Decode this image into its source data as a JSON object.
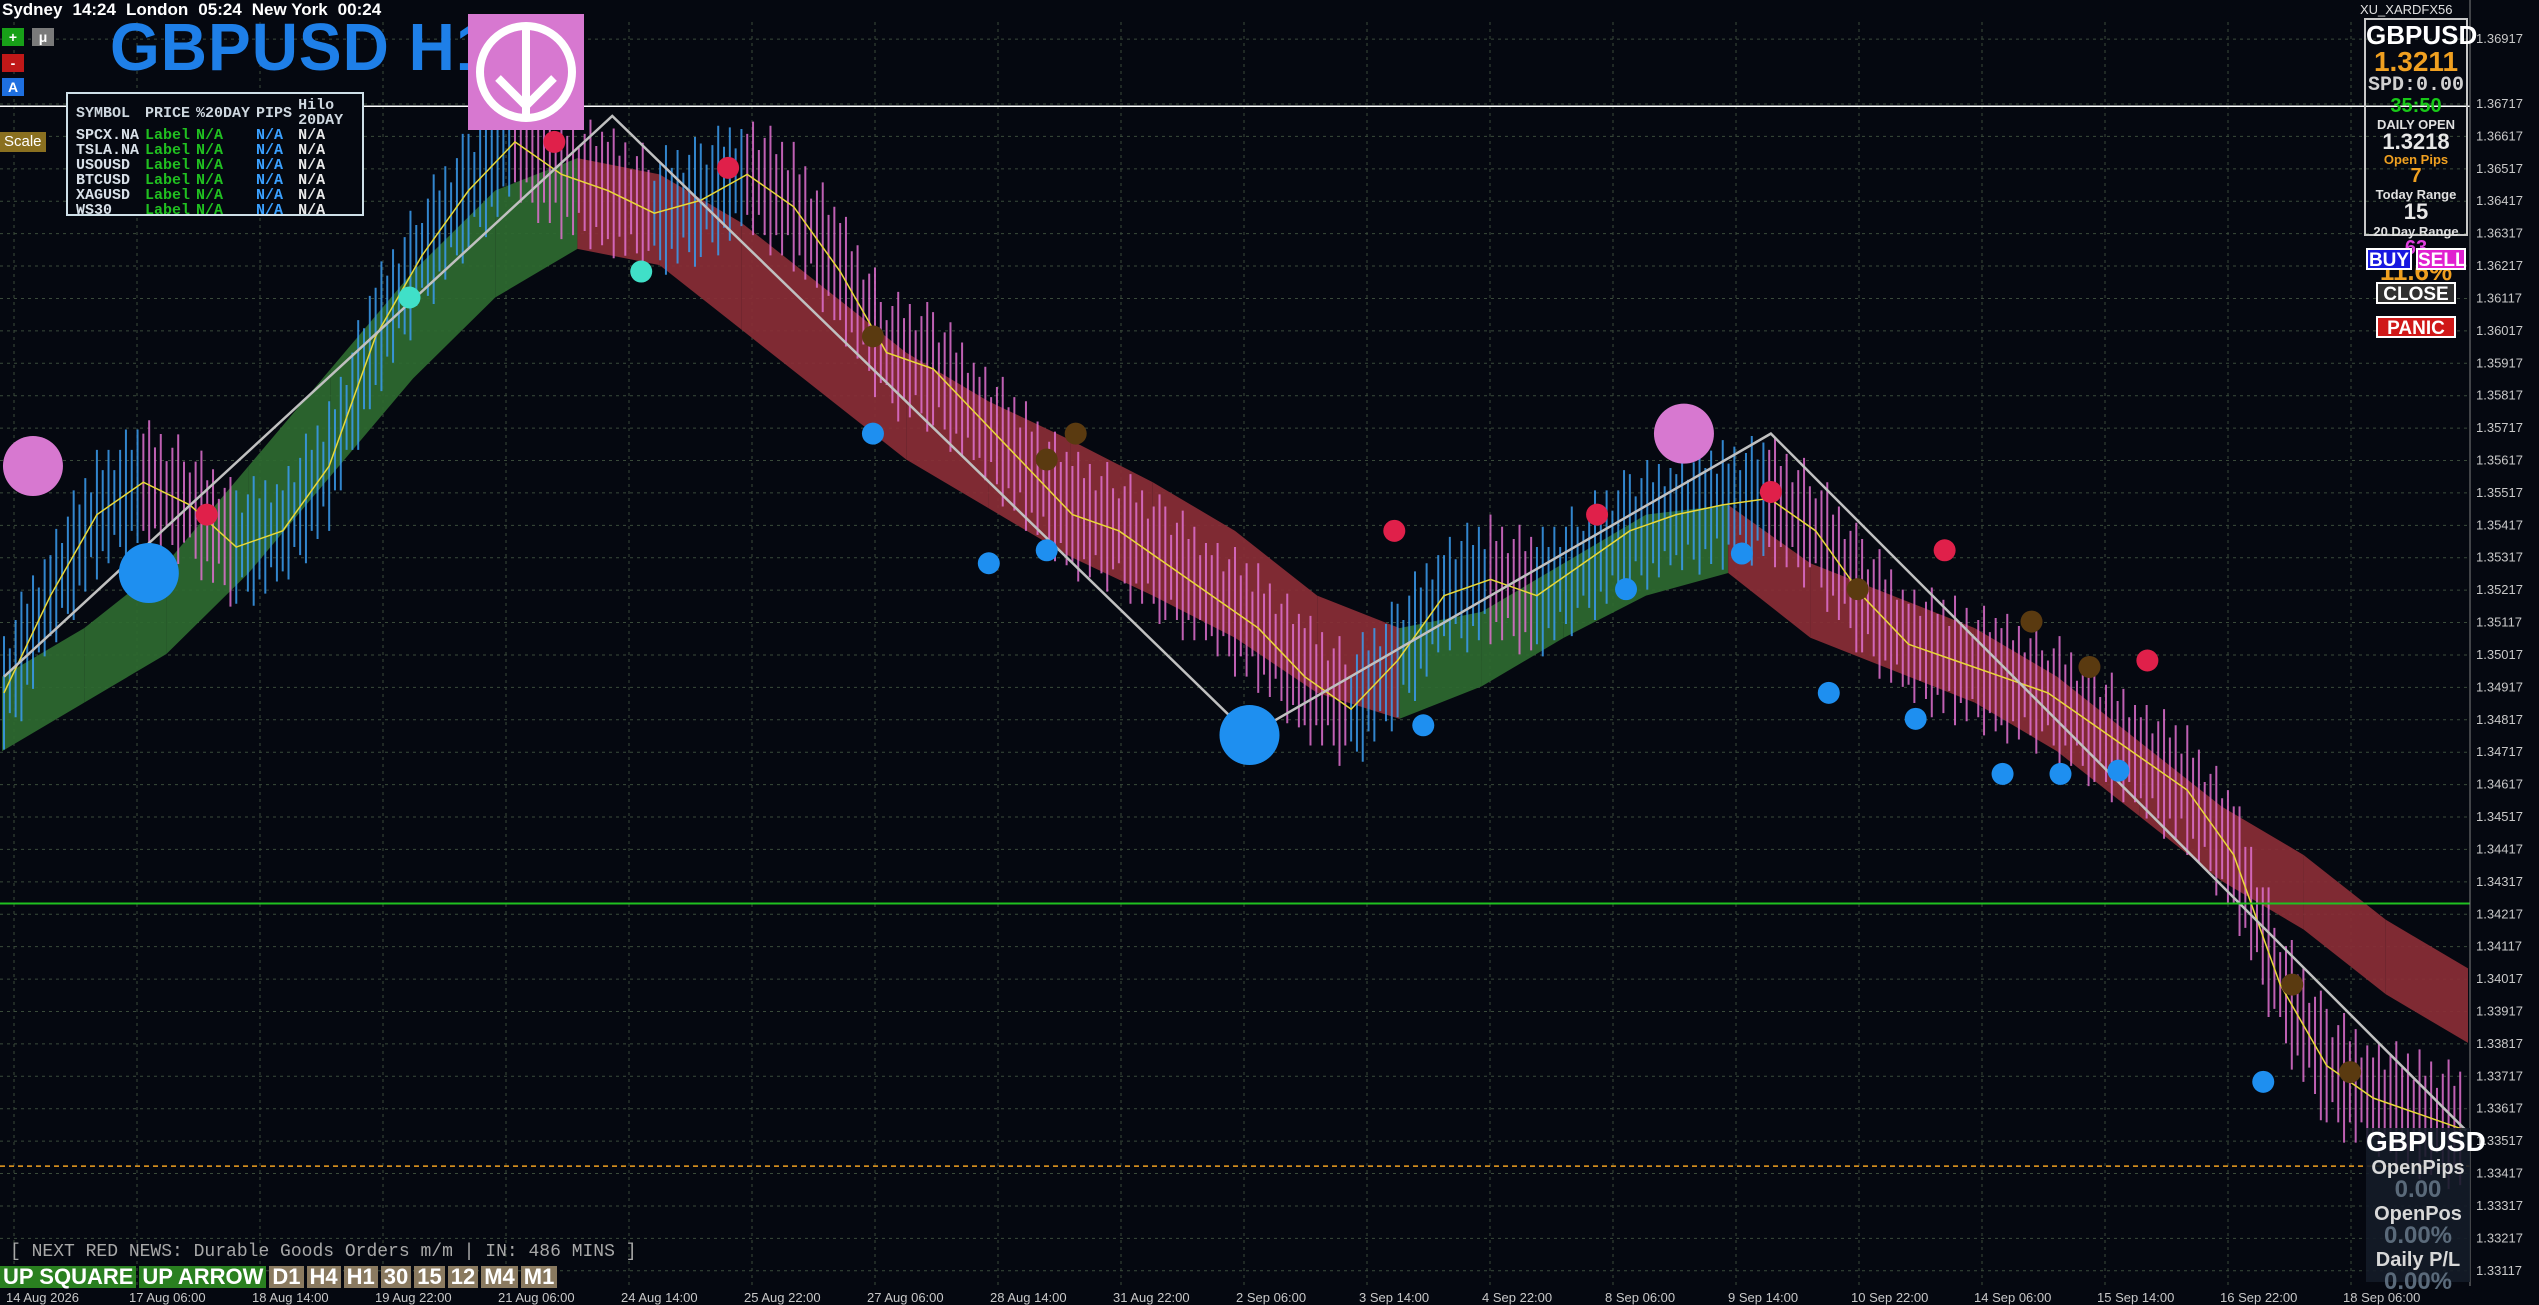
{
  "clock": {
    "city1": "Sydney",
    "time1": "14:24",
    "city2": "London",
    "time2": "05:24",
    "city3": "New York",
    "time3": "00:24"
  },
  "buttons": {
    "plus": "+",
    "mu": "μ",
    "minus": "-",
    "a": "A",
    "scale": "Scale"
  },
  "chart_title": "GBPUSD H1",
  "symbols_table": {
    "headers": [
      "SYMBOL",
      "PRICE",
      "%20DAY",
      "PIPS",
      "Hilo 20DAY"
    ],
    "rows": [
      [
        "SPCX.NA",
        "Label",
        "N/A",
        "N/A",
        "N/A"
      ],
      [
        "TSLA.NA",
        "Label",
        "N/A",
        "N/A",
        "N/A"
      ],
      [
        "USOUSD",
        "Label",
        "N/A",
        "N/A",
        "N/A"
      ],
      [
        "BTCUSD",
        "Label",
        "N/A",
        "N/A",
        "N/A"
      ],
      [
        "XAGUSD",
        "Label",
        "N/A",
        "N/A",
        "N/A"
      ],
      [
        "WS30",
        "Label",
        "N/A",
        "N/A",
        "N/A"
      ]
    ]
  },
  "account": "XU_XARDFX56",
  "info_panel": {
    "symbol": "GBPUSD",
    "price": "1.3211",
    "spread": "SPD:0.00",
    "countdown": "35:50",
    "daily_open_label": "DAILY OPEN",
    "daily_open": "1.3218",
    "open_pips_label": "Open Pips",
    "open_pips": "7",
    "today_range_label": "Today Range",
    "today_range": "15",
    "day20_range_label": "20 Day Range",
    "day20_range": "63",
    "pct": "11.6%"
  },
  "trade_buttons": {
    "buy": "BUY",
    "sell": "SELL",
    "close": "CLOSE",
    "panic": "PANIC"
  },
  "bottom_panel": {
    "symbol": "GBPUSD",
    "open_pips_label": "OpenPips",
    "open_pips": "0.00",
    "open_pos_label": "OpenPos",
    "open_pos": "0.00%",
    "daily_pl_label": "Daily P/L",
    "daily_pl": "0.00%"
  },
  "news": "[ NEXT RED NEWS: Durable Goods Orders m/m | IN: 486 MINS ]",
  "timeframe_bar": {
    "mode": "UP SQUARE",
    "arrow": "UP ARROW",
    "frames": [
      "D1",
      "H4",
      "H1",
      "30",
      "15",
      "12",
      "M4",
      "M1"
    ]
  },
  "colors": {
    "background": "#050810",
    "bull_ribbon": "#2e6a30",
    "bear_ribbon": "#8a2e36",
    "bull_candle": "#3a9cf0",
    "bear_candle": "#e070d0",
    "zigzag": "#c0c0c0",
    "grid": "#3a4a3a",
    "current_price_line": "#ffffff",
    "green_level": "#20c020",
    "orange_level": "#f0a020"
  },
  "chart_data": {
    "type": "line",
    "symbol": "GBPUSD",
    "timeframe": "H1",
    "x_ticks": [
      "14 Aug 2026",
      "17 Aug 06:00",
      "18 Aug 14:00",
      "19 Aug 22:00",
      "21 Aug 06:00",
      "24 Aug 14:00",
      "25 Aug 22:00",
      "27 Aug 06:00",
      "28 Aug 14:00",
      "31 Aug 22:00",
      "2 Sep 06:00",
      "3 Sep 14:00",
      "4 Sep 22:00",
      "8 Sep 06:00",
      "9 Sep 14:00",
      "10 Sep 22:00",
      "14 Sep 06:00",
      "15 Sep 14:00",
      "16 Sep 22:00",
      "18 Sep 06:00"
    ],
    "y_ticks": [
      "1.36917",
      "1.36717",
      "1.36617",
      "1.36517",
      "1.36417",
      "1.36317",
      "1.36217",
      "1.36117",
      "1.36017",
      "1.35917",
      "1.35817",
      "1.35717",
      "1.35617",
      "1.35517",
      "1.35417",
      "1.35317",
      "1.35217",
      "1.35117",
      "1.35017",
      "1.34917",
      "1.34817",
      "1.34717",
      "1.34617",
      "1.34517",
      "1.34417",
      "1.34317",
      "1.34217",
      "1.34117",
      "1.34017",
      "1.33917",
      "1.33817",
      "1.33717",
      "1.33617",
      "1.33517",
      "1.33417",
      "1.33317",
      "1.33217",
      "1.33117"
    ],
    "ylim": [
      1.3307,
      1.3697
    ],
    "close": [
      1.349,
      1.352,
      1.3545,
      1.3555,
      1.3548,
      1.3535,
      1.354,
      1.356,
      1.36,
      1.3625,
      1.3645,
      1.366,
      1.365,
      1.3645,
      1.3638,
      1.3642,
      1.365,
      1.364,
      1.362,
      1.3595,
      1.359,
      1.3575,
      1.356,
      1.3545,
      1.354,
      1.353,
      1.352,
      1.351,
      1.3495,
      1.3485,
      1.35,
      1.352,
      1.3525,
      1.352,
      1.353,
      1.354,
      1.3545,
      1.3548,
      1.355,
      1.354,
      1.352,
      1.3505,
      1.35,
      1.3495,
      1.349,
      1.348,
      1.347,
      1.346,
      1.344,
      1.34,
      1.3375,
      1.3365,
      1.336,
      1.3355
    ],
    "ribbon_upper": [
      1.3495,
      1.351,
      1.353,
      1.356,
      1.359,
      1.362,
      1.3645,
      1.3655,
      1.365,
      1.3635,
      1.3615,
      1.3595,
      1.358,
      1.3568,
      1.3555,
      1.354,
      1.352,
      1.351,
      1.3515,
      1.353,
      1.3545,
      1.3548,
      1.353,
      1.352,
      1.351,
      1.3495,
      1.3475,
      1.3455,
      1.344,
      1.342,
      1.3405
    ],
    "ribbon_lower": [
      1.348,
      1.3495,
      1.351,
      1.3535,
      1.3565,
      1.3595,
      1.362,
      1.3635,
      1.363,
      1.361,
      1.359,
      1.357,
      1.3555,
      1.354,
      1.3528,
      1.3515,
      1.3498,
      1.349,
      1.35,
      1.3515,
      1.3528,
      1.3535,
      1.3515,
      1.3505,
      1.3495,
      1.348,
      1.346,
      1.344,
      1.3425,
      1.3405,
      1.339
    ],
    "zigzag": [
      [
        0,
        1.3495
      ],
      [
        21,
        1.3668
      ],
      [
        43,
        1.3477
      ],
      [
        61,
        1.357
      ],
      [
        85,
        1.3355
      ]
    ],
    "current_price": 1.3671,
    "levels": [
      1.3425,
      1.3344
    ]
  }
}
